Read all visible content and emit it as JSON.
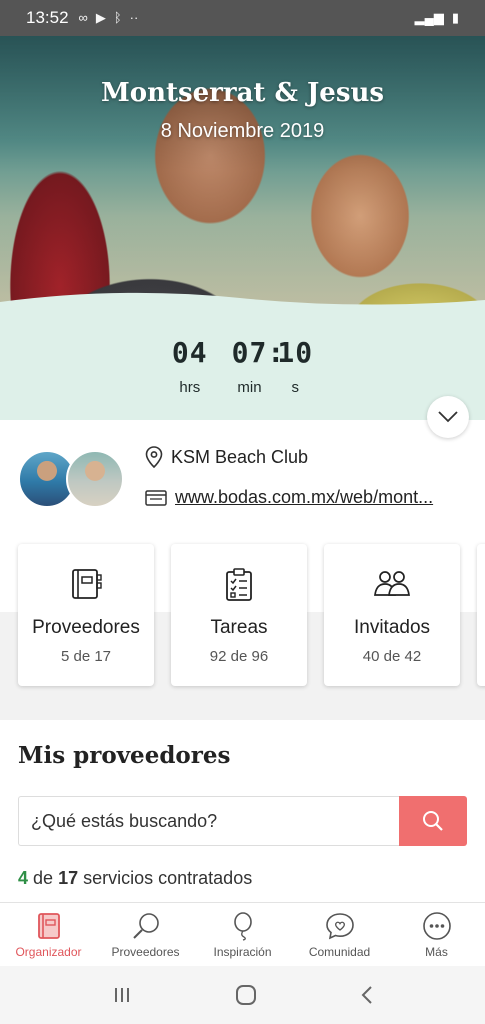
{
  "status_bar": {
    "time": "13:52"
  },
  "hero": {
    "names": "Montserrat & Jesus",
    "date": "8 Noviembre 2019"
  },
  "countdown": {
    "hours": "04",
    "minutes": "07",
    "seconds": "10",
    "hours_label": "hrs",
    "minutes_label": "min",
    "seconds_label": "s"
  },
  "info": {
    "venue": "KSM Beach Club",
    "website": "www.bodas.com.mx/web/mont..."
  },
  "cards": [
    {
      "title": "Proveedores",
      "sub": "5 de 17",
      "icon": "notebook-icon"
    },
    {
      "title": "Tareas",
      "sub": "92 de 96",
      "icon": "checklist-icon"
    },
    {
      "title": "Invitados",
      "sub": "40 de 42",
      "icon": "guests-icon"
    }
  ],
  "section": {
    "title": "Mis proveedores"
  },
  "search": {
    "placeholder": "¿Qué estás buscando?"
  },
  "services": {
    "count": "4",
    "de": "de",
    "total": "17",
    "suffix": "servicios contratados"
  },
  "bottom_nav": [
    {
      "label": "Organizador",
      "icon": "organizer-icon",
      "active": true
    },
    {
      "label": "Proveedores",
      "icon": "magnifier-icon",
      "active": false
    },
    {
      "label": "Inspiración",
      "icon": "balloon-icon",
      "active": false
    },
    {
      "label": "Comunidad",
      "icon": "chat-heart-icon",
      "active": false
    },
    {
      "label": "Más",
      "icon": "more-icon",
      "active": false
    }
  ],
  "colors": {
    "accent": "#e0565b",
    "countdown_bg": "#def0e9",
    "search_button": "#f06f6f",
    "highlight": "#2f8f46"
  }
}
